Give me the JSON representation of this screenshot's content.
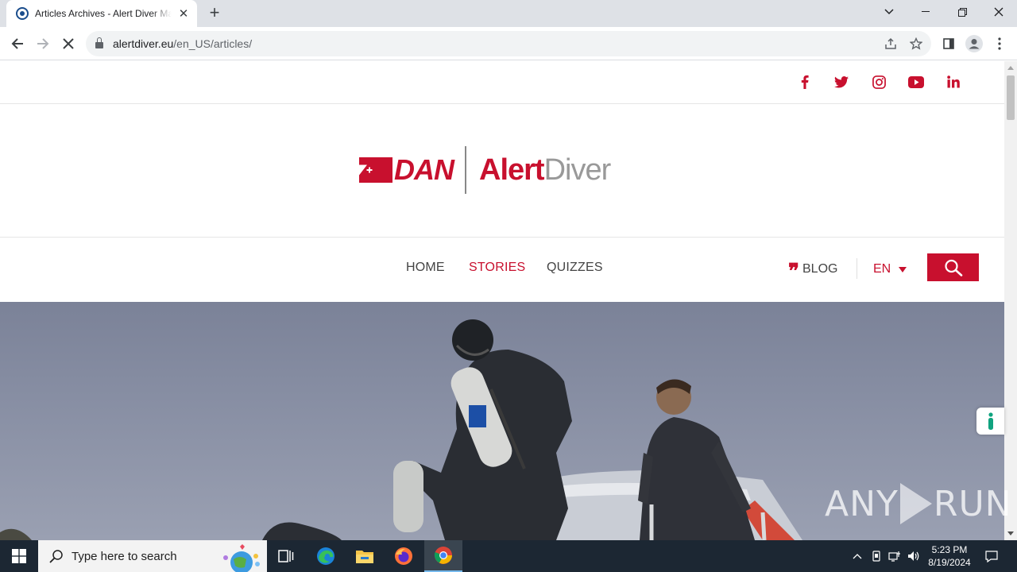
{
  "browser": {
    "tab_title": "Articles Archives - Alert Diver Magazine",
    "url_domain": "alertdiver.eu",
    "url_path": "/en_US/articles/"
  },
  "site": {
    "logo_dan": "DAN",
    "logo_alert": "Alert",
    "logo_diver": "Diver",
    "nav": [
      "HOME",
      "STORIES",
      "QUIZZES"
    ],
    "active_nav": "STORIES",
    "blog_label": "BLOG",
    "language": "EN",
    "social": [
      "facebook-icon",
      "twitter-icon",
      "instagram-icon",
      "youtube-icon",
      "linkedin-icon"
    ],
    "accent_color": "#c8102e"
  },
  "watermark": {
    "left": "ANY",
    "right": "RUN"
  },
  "taskbar": {
    "search_placeholder": "Type here to search",
    "time": "5:23 PM",
    "date": "8/19/2024"
  }
}
